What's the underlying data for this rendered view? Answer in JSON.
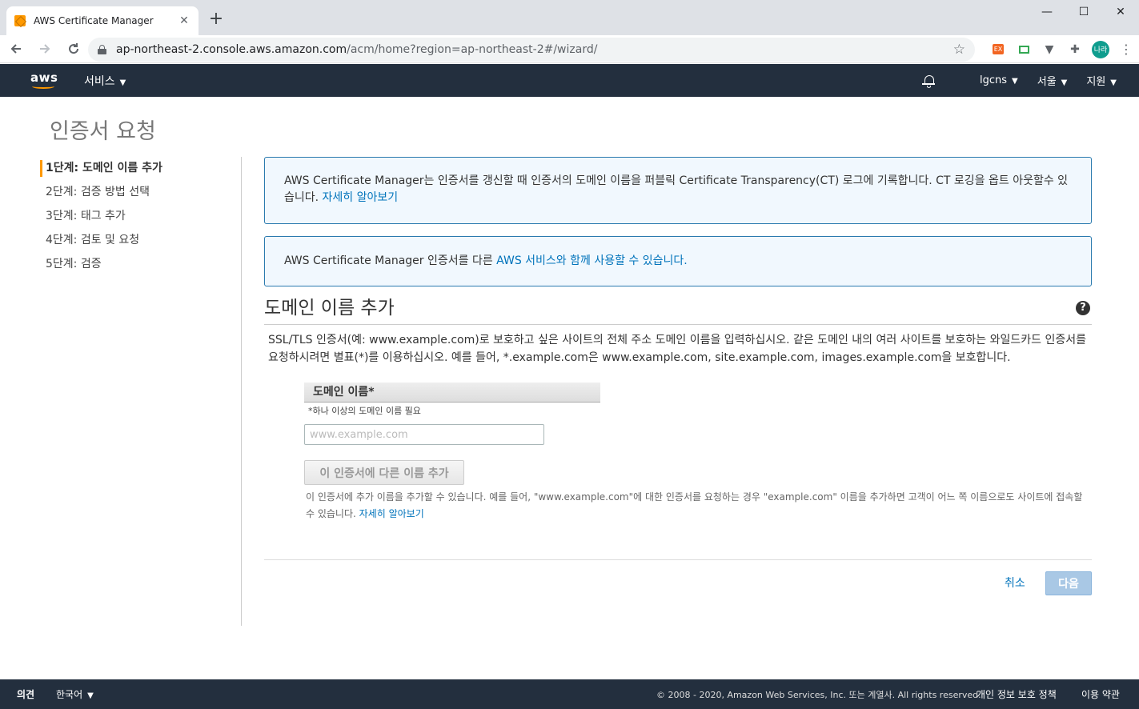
{
  "browser": {
    "tab_title": "AWS Certificate Manager",
    "tab_close": "✕",
    "new_tab": "+",
    "win_min": "—",
    "win_max": "☐",
    "win_close": "✕",
    "url_host": "ap-northeast-2.console.aws.amazon.com",
    "url_path": "/acm/home?region=ap-northeast-2#/wizard/",
    "profile_initial": "나라",
    "ext1_label": "EX"
  },
  "awsnav": {
    "logo": "aws",
    "services": "서비스",
    "account": "lgcns",
    "region": "서울",
    "support": "지원"
  },
  "page": {
    "title": "인증서 요청"
  },
  "steps": [
    {
      "label": "1단계: 도메인 이름 추가"
    },
    {
      "label": "2단계: 검증 방법 선택"
    },
    {
      "label": "3단계: 태그 추가"
    },
    {
      "label": "4단계: 검토 및 요청"
    },
    {
      "label": "5단계: 검증"
    }
  ],
  "alerts": {
    "ct_text": "AWS Certificate Manager는 인증서를 갱신할 때 인증서의 도메인 이름을 퍼블릭 Certificate Transparency(CT) 로그에 기록합니다. CT 로깅을 옵트 아웃할수 있습니다.",
    "ct_link": "자세히 알아보기",
    "services_text": "AWS Certificate Manager 인증서를 다른",
    "services_link": "AWS 서비스와 함께 사용할 수 있습니다."
  },
  "section": {
    "title": "도메인 이름 추가",
    "help": "?",
    "description": "SSL/TLS 인증서(예: www.example.com)로 보호하고 싶은 사이트의 전체 주소 도메인 이름을 입력하십시오. 같은 도메인 내의 여러 사이트를 보호하는 와일드카드 인증서를 요청하시려면 별표(*)를 이용하십시오. 예를 들어, *.example.com은 www.example.com, site.example.com, images.example.com을 보호합니다."
  },
  "form": {
    "field_label": "도메인 이름*",
    "field_hint": "*하나 이상의 도메인 이름 필요",
    "input_placeholder": "www.example.com",
    "input_value": "",
    "add_button": "이 인증서에 다른 이름 추가",
    "add_desc": "이 인증서에 추가 이름을 추가할 수 있습니다. 예를 들어, \"www.example.com\"에 대한 인증서를 요청하는 경우 \"example.com\" 이름을 추가하면 고객이 어느 쪽 이름으로도 사이트에 접속할 수 있습니다.",
    "add_desc_link": "자세히 알아보기"
  },
  "actions": {
    "cancel": "취소",
    "next": "다음"
  },
  "footer": {
    "feedback": "의견",
    "language": "한국어",
    "copyright": "© 2008 - 2020, Amazon Web Services, Inc. 또는 계열사. All rights reserved.",
    "privacy": "개인 정보 보호 정책",
    "terms": "이용 약관"
  },
  "colors": {
    "aws_nav": "#232f3e",
    "accent": "#ff9900",
    "link": "#0073bb",
    "alert_bg": "#f1f8fe"
  }
}
